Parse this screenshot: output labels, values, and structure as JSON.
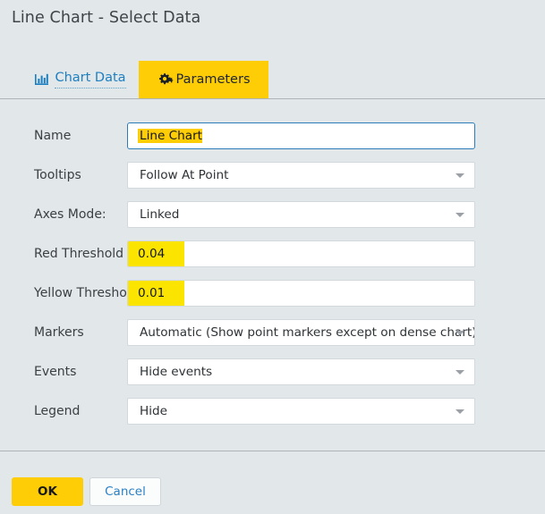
{
  "dialog": {
    "title": "Line Chart - Select Data"
  },
  "tabs": [
    {
      "label": "Chart Data",
      "icon": "bar-chart-icon",
      "active": false
    },
    {
      "label": "Parameters",
      "icon": "gears-icon",
      "active": true
    }
  ],
  "form": {
    "rows": [
      {
        "label": "Name",
        "value": "Line Chart",
        "type": "text",
        "focused": true,
        "selected": true
      },
      {
        "label": "Tooltips",
        "value": "Follow At Point",
        "type": "select",
        "focused": false,
        "selected": false
      },
      {
        "label": "Axes Mode:",
        "value": "Linked",
        "type": "select",
        "focused": false,
        "selected": false
      },
      {
        "label": "Red Threshold",
        "value": "0.04",
        "type": "text",
        "focused": false,
        "selected": true
      },
      {
        "label": "Yellow Threshold",
        "value": "0.01",
        "type": "text",
        "focused": false,
        "selected": true
      },
      {
        "label": "Markers",
        "value": "Automatic (Show point markers except on dense chart)",
        "type": "select",
        "focused": false,
        "selected": false
      },
      {
        "label": "Events",
        "value": "Hide events",
        "type": "select",
        "focused": false,
        "selected": false
      },
      {
        "label": "Legend",
        "value": "Hide",
        "type": "select",
        "focused": false,
        "selected": false
      }
    ]
  },
  "footer": {
    "ok_label": "OK",
    "cancel_label": "Cancel"
  },
  "colors": {
    "accent_yellow": "#fecd06",
    "selection_yellow": "#fbe400",
    "link_blue": "#1d7fc0",
    "focus_blue": "#2d7cb8",
    "background": "#e2e7ea",
    "field_background": "#ffffff",
    "divider": "#adb3b7"
  }
}
